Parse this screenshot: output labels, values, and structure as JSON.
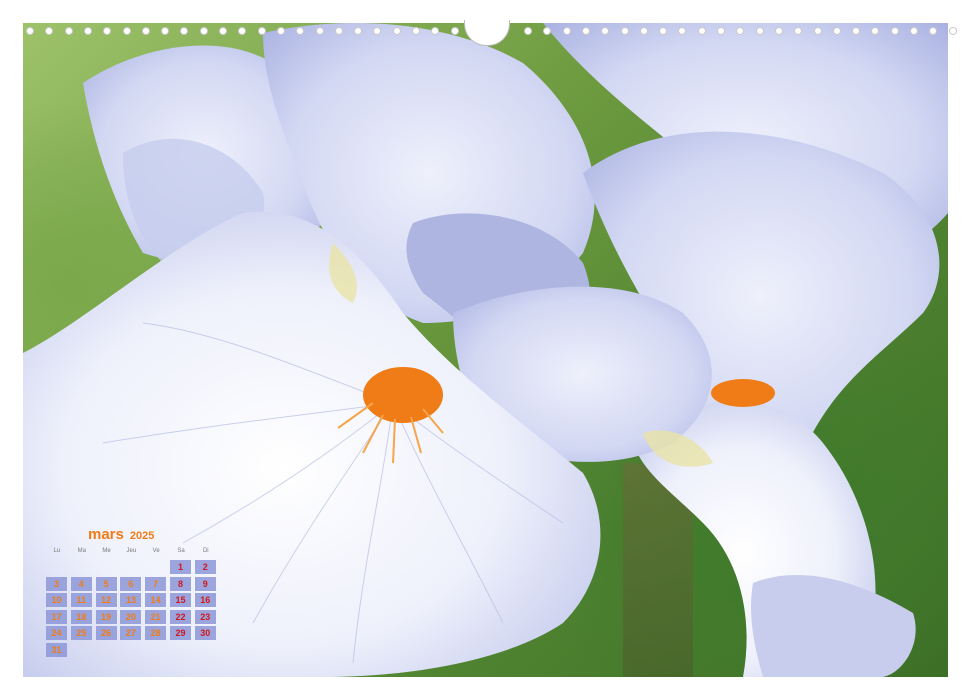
{
  "calendar": {
    "month": "mars",
    "year": "2025",
    "weekdays": [
      "Lu",
      "Ma",
      "Me",
      "Jeu",
      "Ve",
      "Sa",
      "Di"
    ],
    "weeks": [
      [
        "",
        "",
        "",
        "",
        "",
        "1",
        "2"
      ],
      [
        "3",
        "4",
        "5",
        "6",
        "7",
        "8",
        "9"
      ],
      [
        "10",
        "11",
        "12",
        "13",
        "14",
        "15",
        "16"
      ],
      [
        "17",
        "18",
        "19",
        "20",
        "21",
        "22",
        "23"
      ],
      [
        "24",
        "25",
        "26",
        "27",
        "28",
        "29",
        "30"
      ],
      [
        "31",
        "",
        "",
        "",
        "",
        "",
        ""
      ]
    ]
  },
  "photo": {
    "subject": "iris-flower",
    "colors": {
      "petal": "#dfe3f7",
      "petal_shadow": "#b9bfe6",
      "beard": "#f07c17",
      "foliage": "#4e8230"
    }
  },
  "binding": {
    "hole_count": 48
  }
}
